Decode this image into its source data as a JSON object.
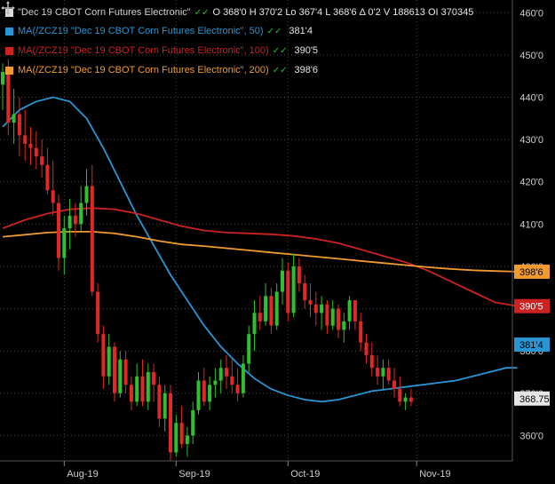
{
  "header": {
    "main_label": "\"Dec 19 CBOT Corn Futures Electronic\"",
    "ohlc_text": "O 368'0  H 370'2  Lo 367'4  L 368'6  Δ 0'2  V 188613  OI 370345",
    "main_swatch": "#dcdcdc"
  },
  "legend": [
    {
      "label": "MA(/ZCZ19 \"Dec 19 CBOT Corn Futures Electronic\", 50)",
      "value": "381'4",
      "color": "#2a95d4"
    },
    {
      "label": "MA(/ZCZ19 \"Dec 19 CBOT Corn Futures Electronic\", 100)",
      "value": "390'5",
      "color": "#cc2222"
    },
    {
      "label": "MA(/ZCZ19 \"Dec 19 CBOT Corn Futures Electronic\", 200)",
      "value": "398'6",
      "color": "#f09a30"
    }
  ],
  "price_tags": [
    {
      "text": "398'6",
      "value": 398.75,
      "bg": "#f09a30",
      "fg": "#000000"
    },
    {
      "text": "390'5",
      "value": 390.6,
      "bg": "#cc2222",
      "fg": "#ffffff"
    },
    {
      "text": "381'4",
      "value": 381.5,
      "bg": "#2a95d4",
      "fg": "#000000"
    },
    {
      "text": "368.75",
      "value": 368.75,
      "bg": "#e6e6e6",
      "fg": "#000000"
    }
  ],
  "chart_data": {
    "type": "candlestick",
    "ylim": [
      354,
      463
    ],
    "y_ticks": [
      360,
      370,
      380,
      390,
      400,
      410,
      420,
      430,
      440,
      450,
      460
    ],
    "y_tick_labels": [
      "360'0",
      "370'0",
      "380'0",
      "390'0",
      "400'0",
      "410'0",
      "420'0",
      "430'0",
      "440'0",
      "450'0",
      "460'0"
    ],
    "x_ticks": [
      {
        "label": "Aug-19",
        "index": 11
      },
      {
        "label": "Sep-19",
        "index": 31
      },
      {
        "label": "Oct-19",
        "index": 51
      },
      {
        "label": "Nov-19",
        "index": 74
      }
    ],
    "colors": {
      "up": "#2fbf2f",
      "down": "#e02828",
      "grid": "#444444"
    },
    "candles": [
      [
        443,
        448,
        437,
        446
      ],
      [
        446,
        449,
        431,
        434
      ],
      [
        434,
        442,
        429,
        436
      ],
      [
        436,
        440,
        426,
        431
      ],
      [
        431,
        437,
        425,
        429
      ],
      [
        429,
        433,
        424,
        428
      ],
      [
        428,
        432,
        423,
        426
      ],
      [
        426,
        430,
        421,
        424
      ],
      [
        424,
        428,
        417,
        418
      ],
      [
        418,
        425,
        412,
        415
      ],
      [
        415,
        417,
        399,
        402
      ],
      [
        402,
        412,
        398,
        409
      ],
      [
        409,
        416,
        404,
        412
      ],
      [
        412,
        415,
        407,
        410
      ],
      [
        410,
        419,
        408,
        415
      ],
      [
        415,
        423,
        412,
        419
      ],
      [
        419,
        424,
        393,
        394
      ],
      [
        394,
        396,
        382,
        384
      ],
      [
        384,
        386,
        371,
        374
      ],
      [
        374,
        384,
        372,
        381
      ],
      [
        381,
        382,
        368,
        370
      ],
      [
        370,
        380,
        369,
        378
      ],
      [
        378,
        380,
        370,
        372
      ],
      [
        372,
        374,
        366,
        368
      ],
      [
        368,
        377,
        367,
        374
      ],
      [
        374,
        378,
        367,
        368
      ],
      [
        368,
        377,
        366,
        375
      ],
      [
        375,
        377,
        368,
        372
      ],
      [
        372,
        374,
        362,
        364
      ],
      [
        364,
        372,
        361,
        370
      ],
      [
        370,
        372,
        354,
        356
      ],
      [
        356,
        365,
        355,
        363
      ],
      [
        363,
        367,
        357,
        358
      ],
      [
        358,
        362,
        355,
        360
      ],
      [
        360,
        368,
        358,
        366
      ],
      [
        366,
        375,
        365,
        373
      ],
      [
        373,
        376,
        367,
        368
      ],
      [
        368,
        374,
        366,
        372
      ],
      [
        372,
        376,
        369,
        373
      ],
      [
        373,
        378,
        370,
        376
      ],
      [
        376,
        379,
        371,
        374
      ],
      [
        374,
        378,
        370,
        372
      ],
      [
        372,
        376,
        368,
        370
      ],
      [
        370,
        379,
        369,
        377
      ],
      [
        377,
        386,
        375,
        384
      ],
      [
        384,
        392,
        380,
        389
      ],
      [
        389,
        393,
        385,
        387
      ],
      [
        387,
        396,
        386,
        393
      ],
      [
        393,
        395,
        384,
        386
      ],
      [
        386,
        396,
        385,
        394
      ],
      [
        394,
        402,
        391,
        399
      ],
      [
        399,
        401,
        387,
        389
      ],
      [
        389,
        403,
        388,
        400
      ],
      [
        400,
        402,
        394,
        396
      ],
      [
        396,
        398,
        390,
        392
      ],
      [
        392,
        396,
        388,
        391
      ],
      [
        391,
        394,
        386,
        389
      ],
      [
        389,
        393,
        385,
        391
      ],
      [
        391,
        392,
        384,
        386
      ],
      [
        386,
        392,
        385,
        390
      ],
      [
        390,
        391,
        383,
        385
      ],
      [
        385,
        389,
        382,
        387
      ],
      [
        387,
        393,
        385,
        392
      ],
      [
        392,
        392,
        385,
        387
      ],
      [
        387,
        389,
        380,
        382
      ],
      [
        382,
        384,
        377,
        379
      ],
      [
        379,
        382,
        374,
        376
      ],
      [
        376,
        379,
        372,
        374
      ],
      [
        374,
        378,
        371,
        376
      ],
      [
        376,
        378,
        372,
        373
      ],
      [
        373,
        376,
        369,
        371
      ],
      [
        371,
        374,
        367,
        368
      ],
      [
        368,
        370,
        366,
        369
      ],
      [
        369,
        371,
        367,
        368
      ]
    ],
    "series": [
      {
        "name": "MA 50",
        "color": "#2a95d4",
        "points": [
          [
            0,
            433
          ],
          [
            3,
            437
          ],
          [
            6,
            439
          ],
          [
            9,
            440
          ],
          [
            12,
            439
          ],
          [
            15,
            435
          ],
          [
            18,
            428
          ],
          [
            21,
            420
          ],
          [
            24,
            412
          ],
          [
            27,
            405
          ],
          [
            30,
            398
          ],
          [
            33,
            392
          ],
          [
            36,
            386
          ],
          [
            39,
            381
          ],
          [
            42,
            377
          ],
          [
            45,
            373.5
          ],
          [
            48,
            371
          ],
          [
            51,
            369.5
          ],
          [
            54,
            368.5
          ],
          [
            57,
            368
          ],
          [
            60,
            368.5
          ],
          [
            63,
            369.5
          ],
          [
            66,
            370.5
          ],
          [
            69,
            371
          ],
          [
            72,
            371.5
          ],
          [
            75,
            372
          ],
          [
            78,
            372.5
          ],
          [
            81,
            373
          ],
          [
            84,
            374
          ],
          [
            87,
            375
          ],
          [
            90,
            376
          ],
          [
            92,
            376
          ]
        ]
      },
      {
        "name": "MA 100",
        "color": "#cc2222",
        "points": [
          [
            0,
            409
          ],
          [
            4,
            411
          ],
          [
            8,
            412.5
          ],
          [
            12,
            413.5
          ],
          [
            16,
            413.8
          ],
          [
            20,
            413.5
          ],
          [
            24,
            412.5
          ],
          [
            28,
            411
          ],
          [
            32,
            409.5
          ],
          [
            36,
            408.5
          ],
          [
            40,
            408
          ],
          [
            44,
            407.8
          ],
          [
            48,
            407.6
          ],
          [
            52,
            407.2
          ],
          [
            56,
            406.5
          ],
          [
            60,
            405.5
          ],
          [
            64,
            404
          ],
          [
            68,
            402.5
          ],
          [
            72,
            401
          ],
          [
            76,
            399
          ],
          [
            80,
            396.5
          ],
          [
            84,
            394
          ],
          [
            88,
            391.5
          ],
          [
            92,
            390.6
          ]
        ]
      },
      {
        "name": "MA 200",
        "color": "#f09a30",
        "points": [
          [
            0,
            407
          ],
          [
            4,
            407.5
          ],
          [
            8,
            408
          ],
          [
            12,
            408.2
          ],
          [
            16,
            408.2
          ],
          [
            20,
            407.8
          ],
          [
            24,
            407
          ],
          [
            28,
            406
          ],
          [
            32,
            405.2
          ],
          [
            36,
            404.8
          ],
          [
            40,
            404.3
          ],
          [
            44,
            403.8
          ],
          [
            48,
            403.3
          ],
          [
            52,
            402.8
          ],
          [
            56,
            402.3
          ],
          [
            60,
            401.8
          ],
          [
            64,
            401.3
          ],
          [
            68,
            400.8
          ],
          [
            72,
            400.3
          ],
          [
            76,
            399.8
          ],
          [
            80,
            399.4
          ],
          [
            84,
            399.1
          ],
          [
            88,
            398.9
          ],
          [
            92,
            398.75
          ]
        ]
      }
    ]
  }
}
